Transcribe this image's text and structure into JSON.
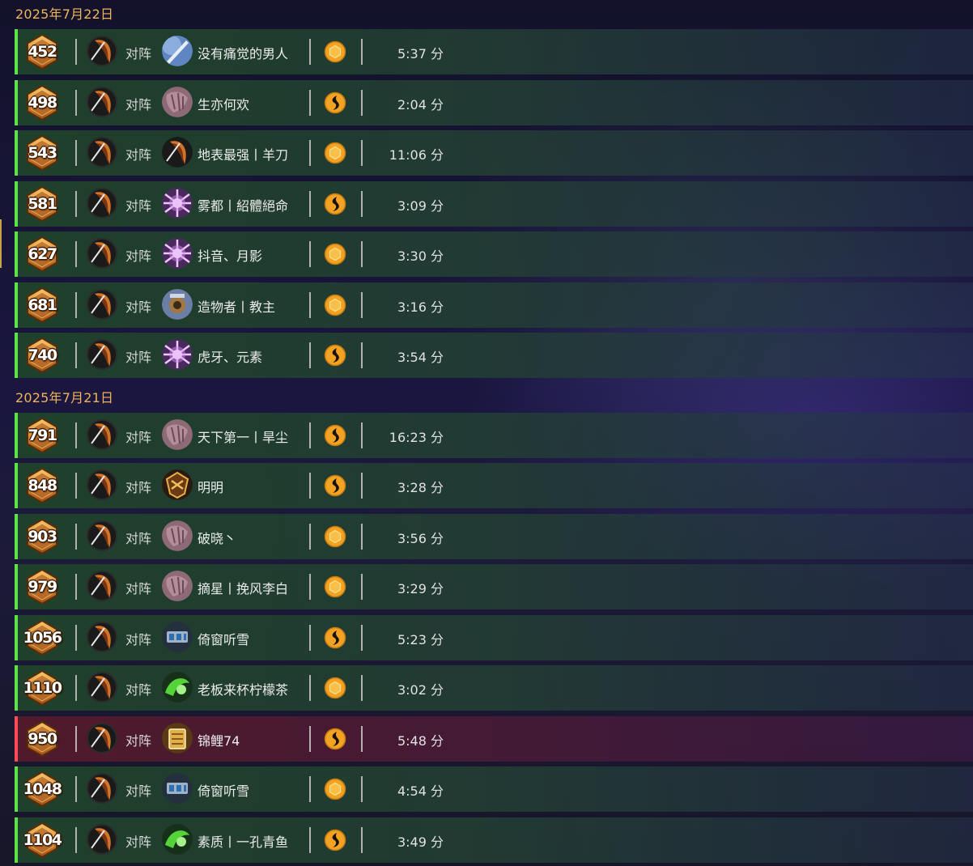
{
  "vs_label": "对阵",
  "duration_unit": "分",
  "groups": [
    {
      "date": "2025年7月22日",
      "rows": [
        {
          "rank": "452",
          "opponent": "没有痛觉的男人",
          "opp_hero": "sword-hero-icon",
          "mode": "coin-icon",
          "duration": "5:37 分",
          "result": "win"
        },
        {
          "rank": "498",
          "opponent": "生亦何欢",
          "opp_hero": "rock-hero-icon",
          "mode": "swirl-icon",
          "duration": "2:04 分",
          "result": "win"
        },
        {
          "rank": "543",
          "opponent": "地表最强丨羊刀",
          "opp_hero": "dark-claw-hero-icon",
          "mode": "coin-icon",
          "duration": "11:06 分",
          "result": "win"
        },
        {
          "rank": "581",
          "opponent": "雾都丨紹體絕命",
          "opp_hero": "spark-hero-icon",
          "mode": "swirl-icon",
          "duration": "3:09 分",
          "result": "win"
        },
        {
          "rank": "627",
          "opponent": "抖音、月影",
          "opp_hero": "spark-hero-icon",
          "mode": "coin-icon",
          "duration": "3:30 分",
          "result": "win"
        },
        {
          "rank": "681",
          "opponent": "造物者丨教主",
          "opp_hero": "mech-hero-icon",
          "mode": "coin-icon",
          "duration": "3:16 分",
          "result": "win"
        },
        {
          "rank": "740",
          "opponent": "虎牙、元素",
          "opp_hero": "spark-hero-icon",
          "mode": "swirl-icon",
          "duration": "3:54 分",
          "result": "win"
        }
      ]
    },
    {
      "date": "2025年7月21日",
      "rows": [
        {
          "rank": "791",
          "opponent": "天下第一丨旱尘",
          "opp_hero": "rock-hero-icon",
          "mode": "swirl-icon",
          "duration": "16:23 分",
          "result": "win"
        },
        {
          "rank": "848",
          "opponent": "明明",
          "opp_hero": "shield-hero-icon",
          "mode": "swirl-icon",
          "duration": "3:28 分",
          "result": "win"
        },
        {
          "rank": "903",
          "opponent": "破晓丶",
          "opp_hero": "rock-hero-icon",
          "mode": "coin-icon",
          "duration": "3:56 分",
          "result": "win"
        },
        {
          "rank": "979",
          "opponent": "摘星丨挽风李白",
          "opp_hero": "rock-hero-icon",
          "mode": "coin-icon",
          "duration": "3:29 分",
          "result": "win"
        },
        {
          "rank": "1056",
          "opponent": "倚窗听雪",
          "opp_hero": "machine-hero-icon",
          "mode": "swirl-icon",
          "duration": "5:23 分",
          "result": "win"
        },
        {
          "rank": "1110",
          "opponent": "老板来杯柠檬茶",
          "opp_hero": "green-hero-icon",
          "mode": "coin-icon",
          "duration": "3:02 分",
          "result": "win"
        },
        {
          "rank": "950",
          "opponent": "锦鲤74",
          "opp_hero": "gold-box-hero-icon",
          "mode": "swirl-icon",
          "duration": "5:48 分",
          "result": "loss"
        },
        {
          "rank": "1048",
          "opponent": "倚窗听雪",
          "opp_hero": "machine-hero-icon",
          "mode": "coin-icon",
          "duration": "4:54 分",
          "result": "win"
        },
        {
          "rank": "1104",
          "opponent": "素质丨一孔青鱼",
          "opp_hero": "green-hero-icon",
          "mode": "swirl-icon",
          "duration": "3:49 分",
          "result": "win"
        }
      ]
    }
  ],
  "colors": {
    "win": "#5ee24a",
    "loss": "#ff4a5a",
    "date": "#f0b45a",
    "mode_gold": "#f2a323"
  }
}
